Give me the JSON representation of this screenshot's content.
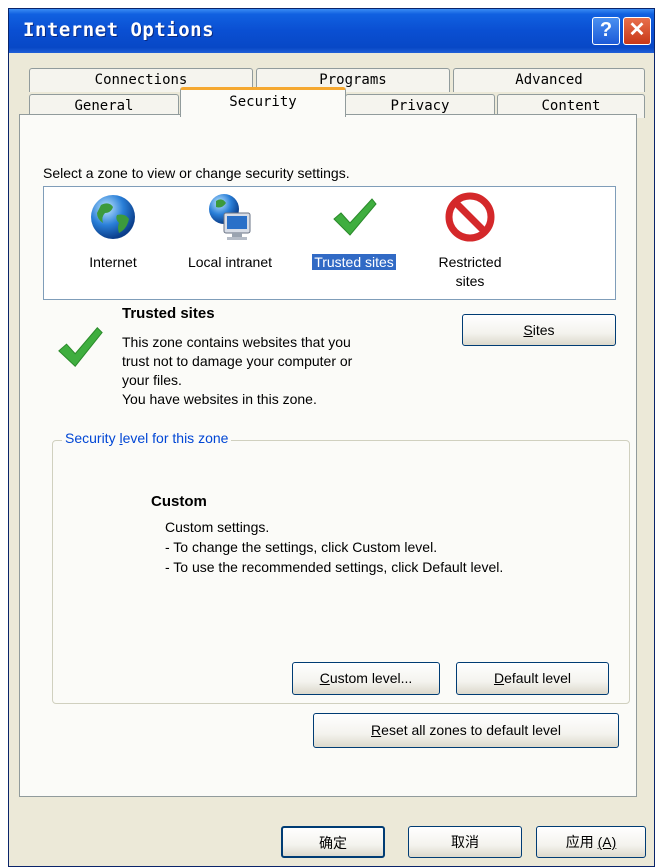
{
  "window": {
    "title": "Internet Options",
    "help_label": "?",
    "close_label": "✕"
  },
  "tabs_row1": [
    "Connections",
    "Programs",
    "Advanced"
  ],
  "tabs_row2": [
    "General",
    "Security",
    "Privacy",
    "Content"
  ],
  "active_tab": "Security",
  "zone_intro": "Select a zone to view or change security settings.",
  "zones": [
    {
      "icon": "globe-icon",
      "label": "Internet",
      "selected": false
    },
    {
      "icon": "local-intranet-icon",
      "label": "Local intranet",
      "selected": false
    },
    {
      "icon": "checkmark-icon",
      "label": "Trusted sites",
      "selected": true
    },
    {
      "icon": "restricted-icon",
      "label_line1": "Restricted",
      "label_line2": "sites",
      "selected": false
    }
  ],
  "selected_zone": {
    "name": "Trusted sites",
    "desc_lines": [
      "This zone contains websites that you",
      "trust not to damage your computer or",
      "your files.",
      "You have websites in this zone."
    ],
    "sites_button": {
      "mnemonic": "S",
      "rest": "ites"
    }
  },
  "security_level": {
    "legend_pre": "Security ",
    "legend_mnemonic": "l",
    "legend_post": "evel for this zone",
    "level_name": "Custom",
    "desc_lines": [
      "Custom settings.",
      "- To change the settings, click Custom level.",
      "- To use the recommended settings, click Default level."
    ],
    "custom_button": {
      "mnemonic": "C",
      "rest": "ustom level..."
    },
    "default_button": {
      "mnemonic": "D",
      "rest": "efault level"
    }
  },
  "reset_button": {
    "mnemonic": "R",
    "rest": "eset all zones to default level"
  },
  "footer": {
    "ok_label": "确定",
    "cancel_label": "取消",
    "apply_label": "应用",
    "apply_mnemonic": "(A)"
  },
  "colors": {
    "title_bar": "#0a4fd2",
    "selection": "#316ac5",
    "check_green": "#3fae3f",
    "restricted_red": "#d4282a"
  }
}
